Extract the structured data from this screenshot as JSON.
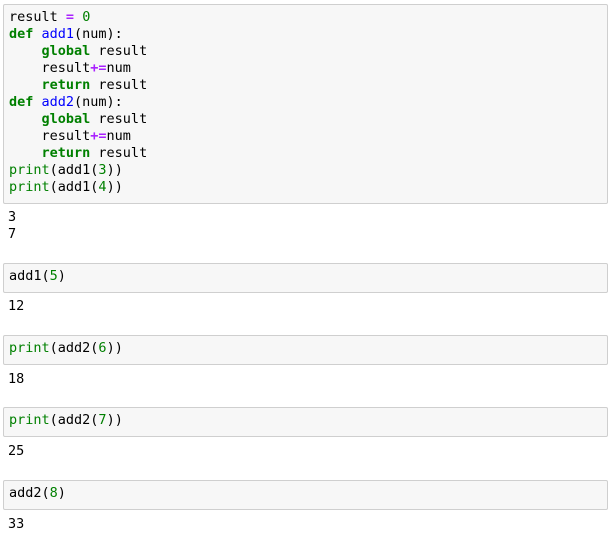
{
  "cells": [
    {
      "lines": [
        [
          {
            "t": "result ",
            "c": "tx"
          },
          {
            "t": "=",
            "c": "op"
          },
          {
            "t": " ",
            "c": "tx"
          },
          {
            "t": "0",
            "c": "num"
          }
        ],
        [
          {
            "t": "def",
            "c": "kw"
          },
          {
            "t": " ",
            "c": "tx"
          },
          {
            "t": "add1",
            "c": "fn"
          },
          {
            "t": "(num):",
            "c": "tx"
          }
        ],
        [
          {
            "t": "    ",
            "c": "tx"
          },
          {
            "t": "global",
            "c": "kw"
          },
          {
            "t": " result",
            "c": "tx"
          }
        ],
        [
          {
            "t": "    result",
            "c": "tx"
          },
          {
            "t": "+=",
            "c": "op"
          },
          {
            "t": "num",
            "c": "tx"
          }
        ],
        [
          {
            "t": "    ",
            "c": "tx"
          },
          {
            "t": "return",
            "c": "kw"
          },
          {
            "t": " result",
            "c": "tx"
          }
        ],
        [
          {
            "t": "def",
            "c": "kw"
          },
          {
            "t": " ",
            "c": "tx"
          },
          {
            "t": "add2",
            "c": "fn"
          },
          {
            "t": "(num):",
            "c": "tx"
          }
        ],
        [
          {
            "t": "    ",
            "c": "tx"
          },
          {
            "t": "global",
            "c": "kw"
          },
          {
            "t": " result",
            "c": "tx"
          }
        ],
        [
          {
            "t": "    result",
            "c": "tx"
          },
          {
            "t": "+=",
            "c": "op"
          },
          {
            "t": "num",
            "c": "tx"
          }
        ],
        [
          {
            "t": "    ",
            "c": "tx"
          },
          {
            "t": "return",
            "c": "kw"
          },
          {
            "t": " result",
            "c": "tx"
          }
        ],
        [
          {
            "t": "print",
            "c": "bi"
          },
          {
            "t": "(add1(",
            "c": "tx"
          },
          {
            "t": "3",
            "c": "num"
          },
          {
            "t": "))",
            "c": "tx"
          }
        ],
        [
          {
            "t": "print",
            "c": "bi"
          },
          {
            "t": "(add1(",
            "c": "tx"
          },
          {
            "t": "4",
            "c": "num"
          },
          {
            "t": "))",
            "c": "tx"
          }
        ]
      ],
      "output": [
        "3",
        "7"
      ]
    },
    {
      "lines": [
        [
          {
            "t": "add1(",
            "c": "tx"
          },
          {
            "t": "5",
            "c": "num"
          },
          {
            "t": ")",
            "c": "tx"
          }
        ]
      ],
      "output": [
        "12"
      ]
    },
    {
      "lines": [
        [
          {
            "t": "print",
            "c": "bi"
          },
          {
            "t": "(add2(",
            "c": "tx"
          },
          {
            "t": "6",
            "c": "num"
          },
          {
            "t": "))",
            "c": "tx"
          }
        ]
      ],
      "output": [
        "18"
      ]
    },
    {
      "lines": [
        [
          {
            "t": "print",
            "c": "bi"
          },
          {
            "t": "(add2(",
            "c": "tx"
          },
          {
            "t": "7",
            "c": "num"
          },
          {
            "t": "))",
            "c": "tx"
          }
        ]
      ],
      "output": [
        "25"
      ]
    },
    {
      "lines": [
        [
          {
            "t": "add2(",
            "c": "tx"
          },
          {
            "t": "8",
            "c": "num"
          },
          {
            "t": ")",
            "c": "tx"
          }
        ]
      ],
      "output": [
        "33"
      ]
    }
  ]
}
